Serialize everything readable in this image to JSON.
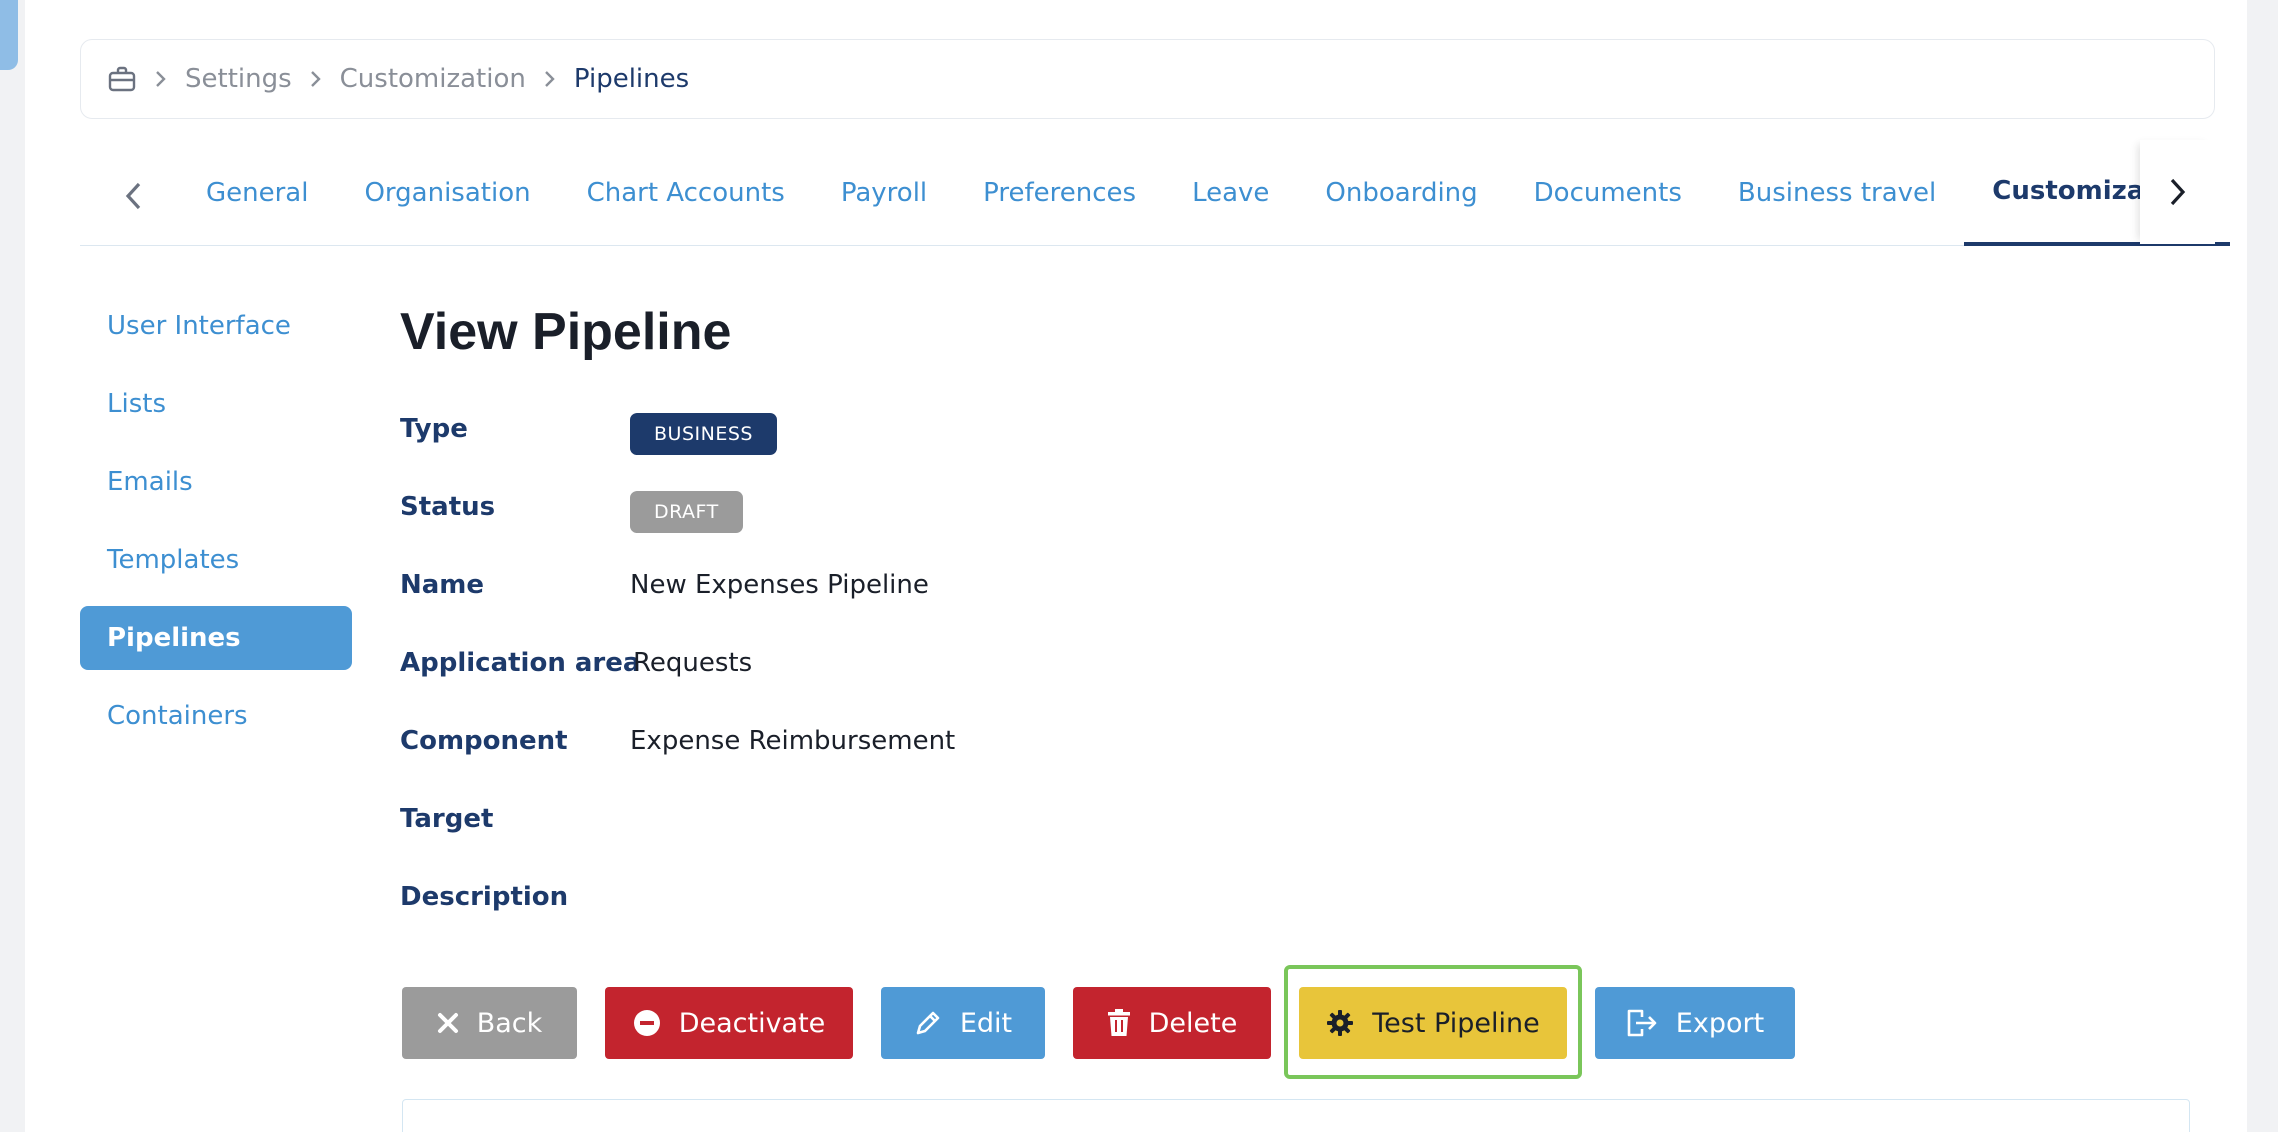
{
  "breadcrumb": {
    "icon": "briefcase-icon",
    "items": [
      "Settings",
      "Customization"
    ],
    "current": "Pipelines"
  },
  "tabs": [
    {
      "label": "General"
    },
    {
      "label": "Organisation"
    },
    {
      "label": "Chart Accounts"
    },
    {
      "label": "Payroll"
    },
    {
      "label": "Preferences"
    },
    {
      "label": "Leave"
    },
    {
      "label": "Onboarding"
    },
    {
      "label": "Documents"
    },
    {
      "label": "Business travel"
    },
    {
      "label": "Customization",
      "active": true
    }
  ],
  "sidebar": {
    "items": [
      {
        "label": "User Interface"
      },
      {
        "label": "Lists"
      },
      {
        "label": "Emails"
      },
      {
        "label": "Templates"
      },
      {
        "label": "Pipelines",
        "active": true
      },
      {
        "label": "Containers"
      }
    ]
  },
  "main": {
    "title": "View Pipeline",
    "fields": {
      "type": {
        "label": "Type",
        "value": "BUSINESS"
      },
      "status": {
        "label": "Status",
        "value": "DRAFT"
      },
      "name": {
        "label": "Name",
        "value": "New Expenses Pipeline"
      },
      "application_area": {
        "label": "Application area",
        "value": "Requests"
      },
      "component": {
        "label": "Component",
        "value": "Expense Reimbursement"
      },
      "target": {
        "label": "Target",
        "value": ""
      },
      "description": {
        "label": "Description",
        "value": ""
      }
    }
  },
  "buttons": {
    "back": "Back",
    "deactivate": "Deactivate",
    "edit": "Edit",
    "delete": "Delete",
    "test": "Test Pipeline",
    "export": "Export"
  },
  "colors": {
    "primary_dark": "#1d3a6b",
    "link_blue": "#3d8fd1",
    "button_blue": "#4f9ad6",
    "danger_red": "#c3242e",
    "warning_yellow": "#e8c53a",
    "neutral_gray": "#9b9b9b",
    "highlight_green": "#7ac65a"
  }
}
